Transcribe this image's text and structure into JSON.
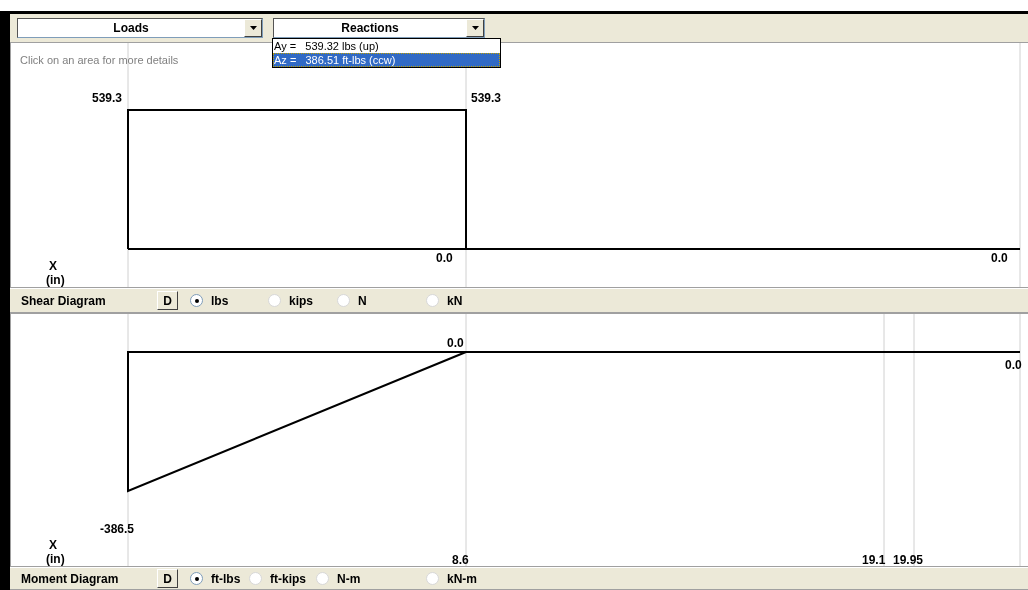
{
  "dropdowns": [
    {
      "value": "Loads"
    },
    {
      "value": "Reactions",
      "expanded": true,
      "items": [
        {
          "text": "Ay =   539.32 lbs (up)",
          "selected": false
        },
        {
          "text": "Az =   386.51 ft-lbs (ccw)",
          "selected": true
        }
      ]
    }
  ],
  "shear_diagram": {
    "hint": "Click on an area for more details",
    "axis": "X",
    "unit": "(in)",
    "labels": [
      "539.3",
      "539.3",
      "0.0",
      "0.0"
    ]
  },
  "shear_toolbar": {
    "title": "Shear Diagram",
    "button": "D",
    "units": [
      {
        "label": "lbs",
        "selected": true
      },
      {
        "label": "kips",
        "selected": false
      },
      {
        "label": "N",
        "selected": false
      },
      {
        "label": "kN",
        "selected": false
      }
    ]
  },
  "moment_diagram": {
    "axis": "X",
    "unit": "(in)",
    "labels": [
      "0.0",
      "0.0",
      "-386.5",
      "8.6",
      "19.1",
      "19.95"
    ]
  },
  "moment_toolbar": {
    "title": "Moment Diagram",
    "button": "D",
    "units": [
      {
        "label": "ft-lbs",
        "selected": true
      },
      {
        "label": "ft-kips",
        "selected": false
      },
      {
        "label": "N-m",
        "selected": false
      },
      {
        "label": "kN-m",
        "selected": false
      }
    ]
  }
}
